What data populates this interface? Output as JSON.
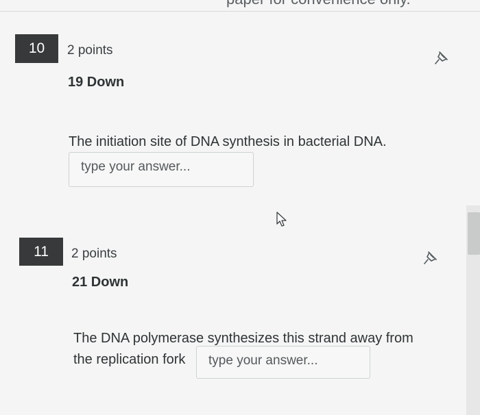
{
  "header": {
    "partial_text": "paper for convenience only."
  },
  "questions": [
    {
      "number": "10",
      "points": "2 points",
      "clue": "19 Down",
      "prompt": "The initiation site of DNA synthesis in bacterial DNA.",
      "placeholder": "type your answer...",
      "pin_icon": "pin-icon"
    },
    {
      "number": "11",
      "points": "2 points",
      "clue": "21 Down",
      "prompt_line1": "The DNA polymerase synthesizes this strand away from",
      "prompt_line2": "the replication fork",
      "placeholder": "type your answer...",
      "pin_icon": "pin-icon"
    }
  ],
  "colors": {
    "background": "#f4f5f4",
    "question_number_bg": "#37393a",
    "text": "#2f3335"
  }
}
